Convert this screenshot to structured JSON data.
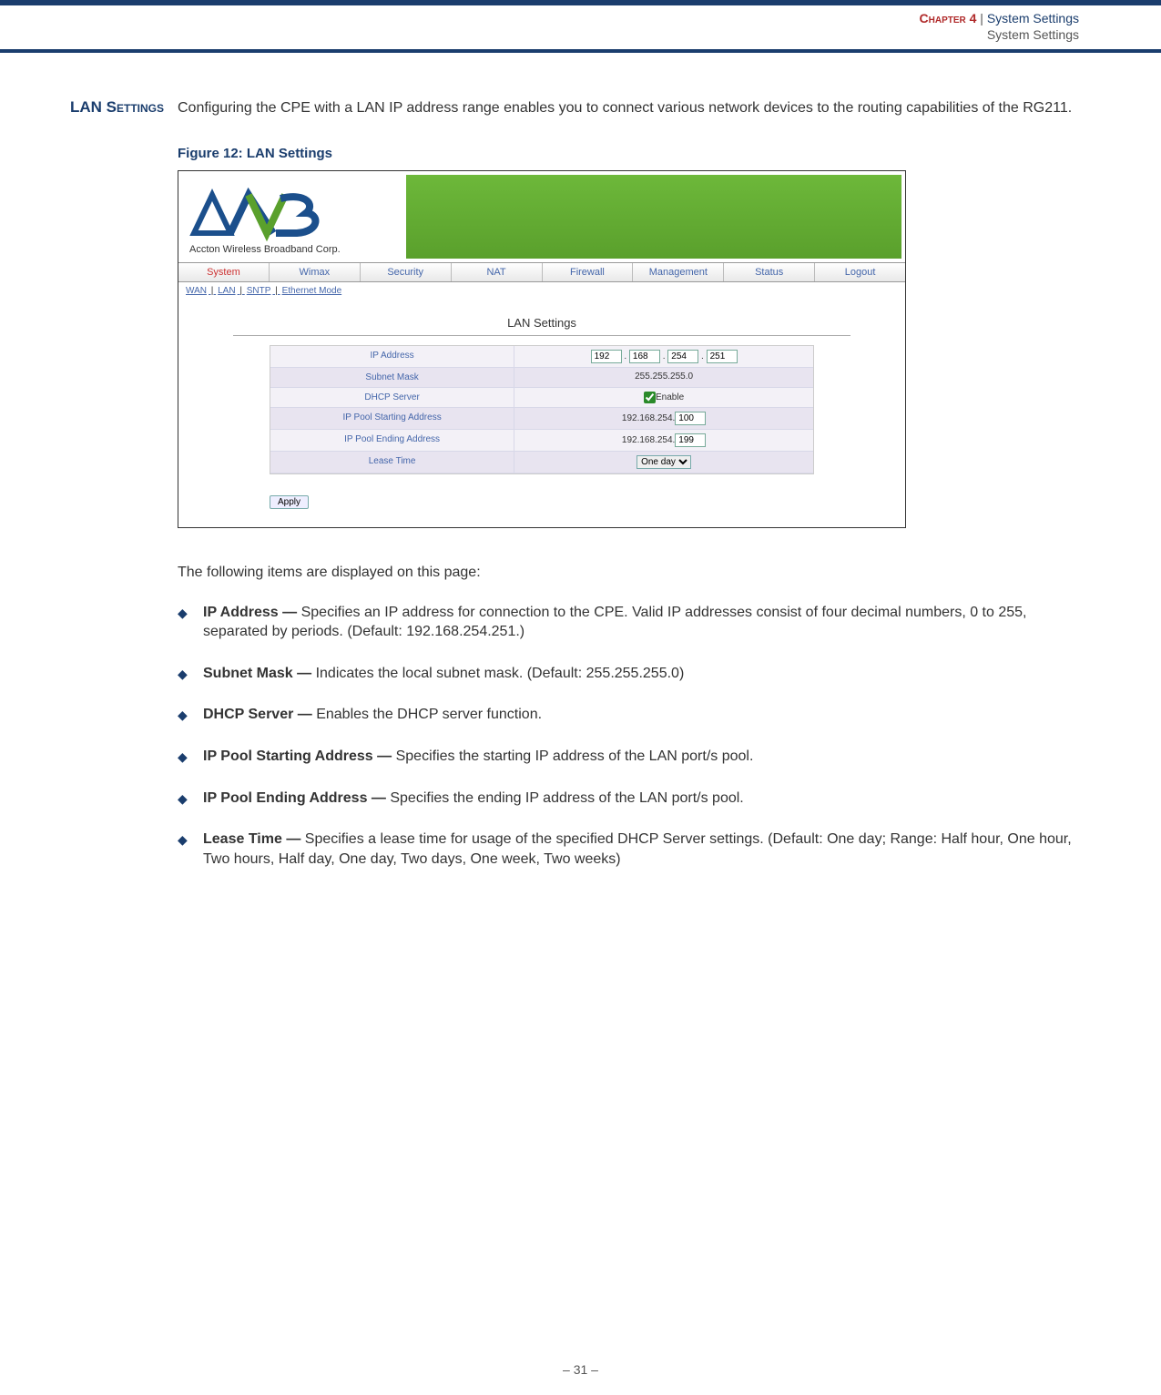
{
  "header": {
    "chapter": "Chapter 4",
    "sep": "  |  ",
    "title": "System Settings",
    "subtitle": "System Settings"
  },
  "section_label": "LAN Settings",
  "intro": "Configuring the CPE with a LAN IP address range enables you to connect various network devices to the routing capabilities of the RG211.",
  "figure_caption": "Figure 12:  LAN Settings",
  "screenshot": {
    "logo_sub": "Accton Wireless Broadband Corp.",
    "tabs": [
      "System",
      "Wimax",
      "Security",
      "NAT",
      "Firewall",
      "Management",
      "Status",
      "Logout"
    ],
    "subnav": [
      "WAN",
      "LAN",
      "SNTP",
      "Ethernet Mode"
    ],
    "panel_title": "LAN Settings",
    "rows": {
      "ip_label": "IP Address",
      "ip_vals": [
        "192",
        "168",
        "254",
        "251"
      ],
      "subnet_label": "Subnet Mask",
      "subnet_value": "255.255.255.0",
      "dhcp_label": "DHCP Server",
      "dhcp_check_label": "Enable",
      "pool_start_label": "IP Pool Starting Address",
      "pool_start_prefix": "192.168.254.",
      "pool_start_val": "100",
      "pool_end_label": "IP Pool Ending Address",
      "pool_end_prefix": "192.168.254.",
      "pool_end_val": "199",
      "lease_label": "Lease Time",
      "lease_val": "One day"
    },
    "apply": "Apply"
  },
  "following_intro": "The following items are displayed on this page:",
  "items": [
    {
      "term": "IP Address — ",
      "body": "Specifies an IP address for connection to the CPE. Valid IP addresses consist of four decimal numbers, 0 to 255, separated by periods. (Default: 192.168.254.251.)"
    },
    {
      "term": "Subnet Mask — ",
      "body": "Indicates the local subnet mask. (Default: 255.255.255.0)"
    },
    {
      "term": "DHCP Server — ",
      "body": "Enables the DHCP server function."
    },
    {
      "term": "IP Pool Starting Address — ",
      "body": "Specifies the starting IP address of the LAN port/s pool."
    },
    {
      "term": "IP Pool Ending Address — ",
      "body": "Specifies the ending IP address of the LAN port/s pool."
    },
    {
      "term": "Lease Time — ",
      "body": "Specifies a lease time for usage of the specified DHCP Server settings. (Default: One day; Range: Half hour, One hour, Two hours, Half day, One day, Two days, One week, Two weeks)"
    }
  ],
  "page_number": "–  31  –"
}
